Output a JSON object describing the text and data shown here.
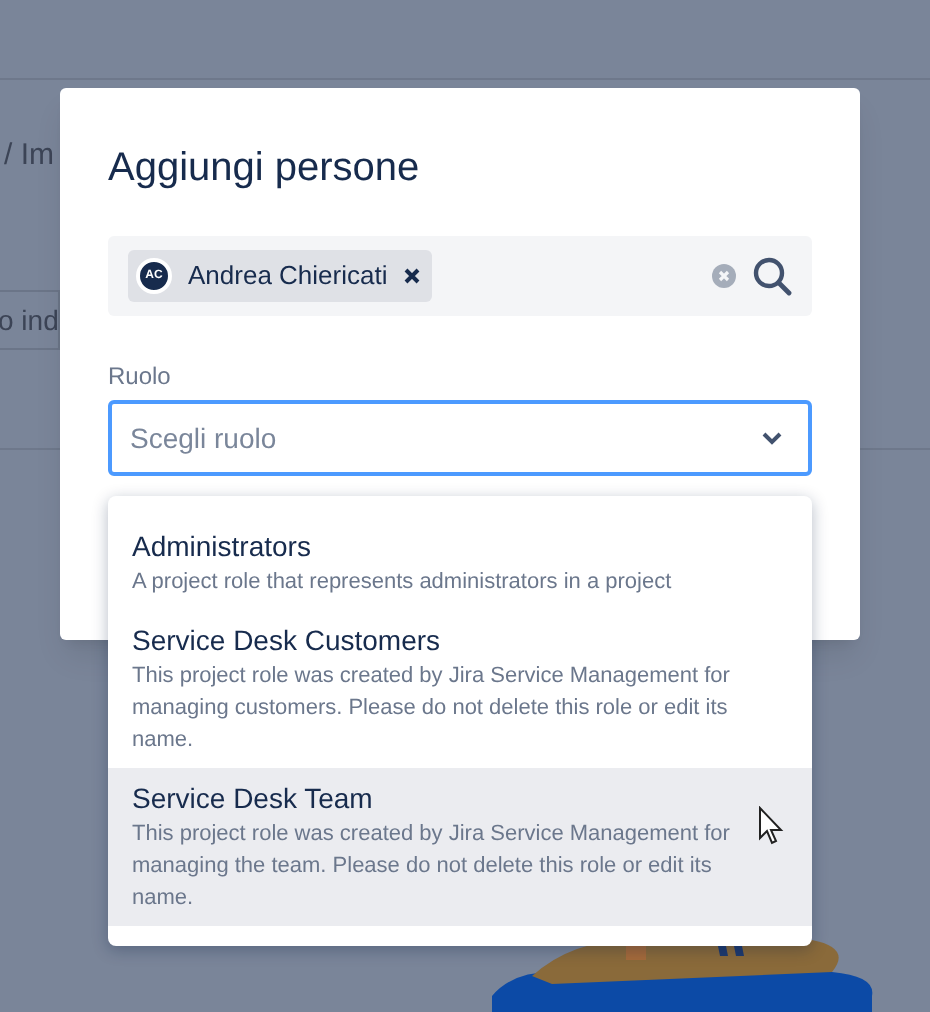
{
  "background": {
    "breadcrumb": "/ Im",
    "field_value": "o ind"
  },
  "dialog": {
    "title": "Aggiungi persone",
    "people_field": {
      "chips": [
        {
          "initials": "AC",
          "name": "Andrea Chiericati"
        }
      ]
    },
    "role_label": "Ruolo",
    "role_select": {
      "placeholder": "Scegli ruolo",
      "expanded": true
    },
    "options": [
      {
        "title": "Administrators",
        "description": "A project role that represents administrators in a project",
        "selected": false
      },
      {
        "title": "Service Desk Customers",
        "description": "This project role was created by Jira Service Management for managing customers. Please do not delete this role or edit its name.",
        "selected": false
      },
      {
        "title": "Service Desk Team",
        "description": "This project role was created by Jira Service Management for managing the team. Please do not delete this role or edit its name.",
        "selected": true
      }
    ]
  }
}
